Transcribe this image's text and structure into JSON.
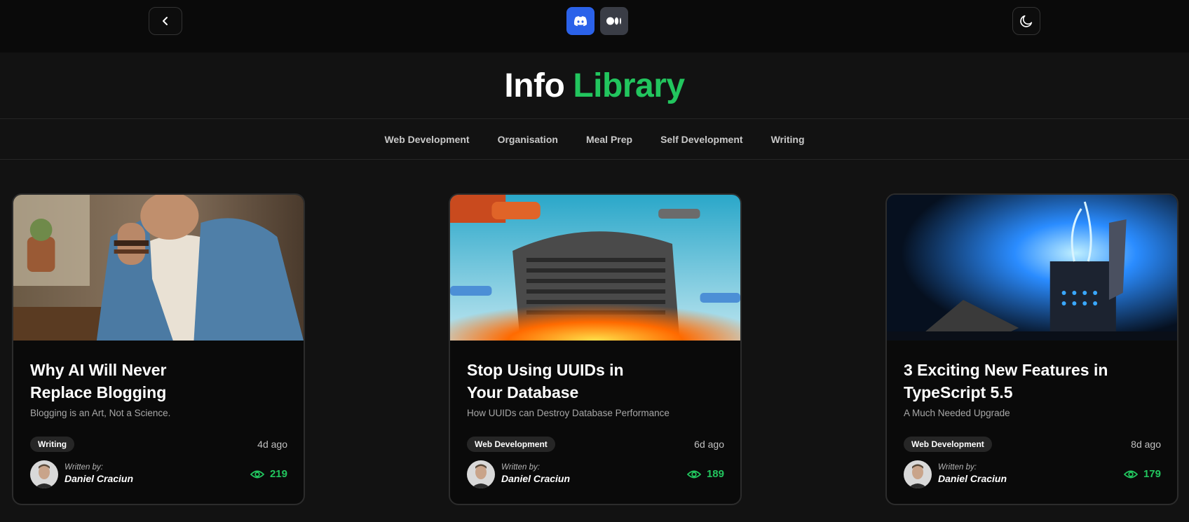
{
  "header": {
    "back_icon": "chevron-left-icon",
    "discord_icon": "discord-icon",
    "medium_icon": "medium-icon",
    "theme_icon": "moon-icon",
    "colors": {
      "discord": "#2b62e9",
      "medium": "#3a3d46",
      "accent": "#22c55e"
    }
  },
  "title": {
    "part1": "Info",
    "part2": "Library"
  },
  "nav": {
    "items": [
      {
        "label": "Web Development"
      },
      {
        "label": "Organisation"
      },
      {
        "label": "Meal Prep"
      },
      {
        "label": "Self Development"
      },
      {
        "label": "Writing"
      }
    ]
  },
  "posts": [
    {
      "title_line1": "Why AI Will Never",
      "title_line2": "Replace Blogging",
      "subtitle": "Blogging is an Art, Not a Science.",
      "tag": "Writing",
      "age": "4d ago",
      "written_by": "Written by:",
      "author": "Daniel Craciun",
      "views": "219"
    },
    {
      "title_line1": "Stop Using UUIDs in",
      "title_line2": "Your Database",
      "subtitle": "How UUIDs can Destroy Database Performance",
      "tag": "Web Development",
      "age": "6d ago",
      "written_by": "Written by:",
      "author": "Daniel Craciun",
      "views": "189"
    },
    {
      "title_line1": "3 Exciting New Features in",
      "title_line2": "TypeScript 5.5",
      "subtitle": "A Much Needed Upgrade",
      "tag": "Web Development",
      "age": "8d ago",
      "written_by": "Written by:",
      "author": "Daniel Craciun",
      "views": "179"
    }
  ]
}
